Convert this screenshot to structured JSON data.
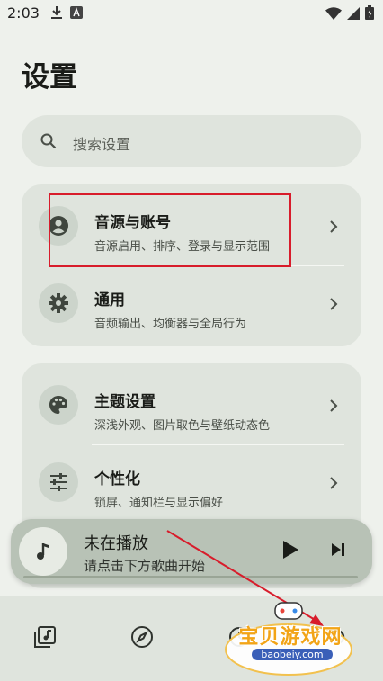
{
  "status_bar": {
    "time": "2:03"
  },
  "page": {
    "title": "设置"
  },
  "search": {
    "placeholder": "搜索设置"
  },
  "groups": [
    {
      "items": [
        {
          "title": "音源与账号",
          "subtitle": "音源启用、排序、登录与显示范围",
          "icon": "account-icon"
        },
        {
          "title": "通用",
          "subtitle": "音频输出、均衡器与全局行为",
          "icon": "gear-icon"
        }
      ]
    },
    {
      "items": [
        {
          "title": "主题设置",
          "subtitle": "深浅外观、图片取色与壁纸动态色",
          "icon": "palette-icon"
        },
        {
          "title": "个性化",
          "subtitle": "锁屏、通知栏与显示偏好",
          "icon": "tune-icon"
        }
      ]
    }
  ],
  "player": {
    "title": "未在播放",
    "subtitle": "请点击下方歌曲开始"
  },
  "bottom_nav": [
    {
      "icon": "music-library-icon"
    },
    {
      "icon": "compass-icon"
    },
    {
      "icon": "history-icon"
    },
    {
      "icon": "settings-icon"
    }
  ],
  "watermark": {
    "text": "宝贝游戏网",
    "url": "baobeiy.com"
  },
  "colors": {
    "background": "#eef1ec",
    "card": "#dfe4dd",
    "highlight": "#d81c2b",
    "player": "#b8c2b6"
  }
}
